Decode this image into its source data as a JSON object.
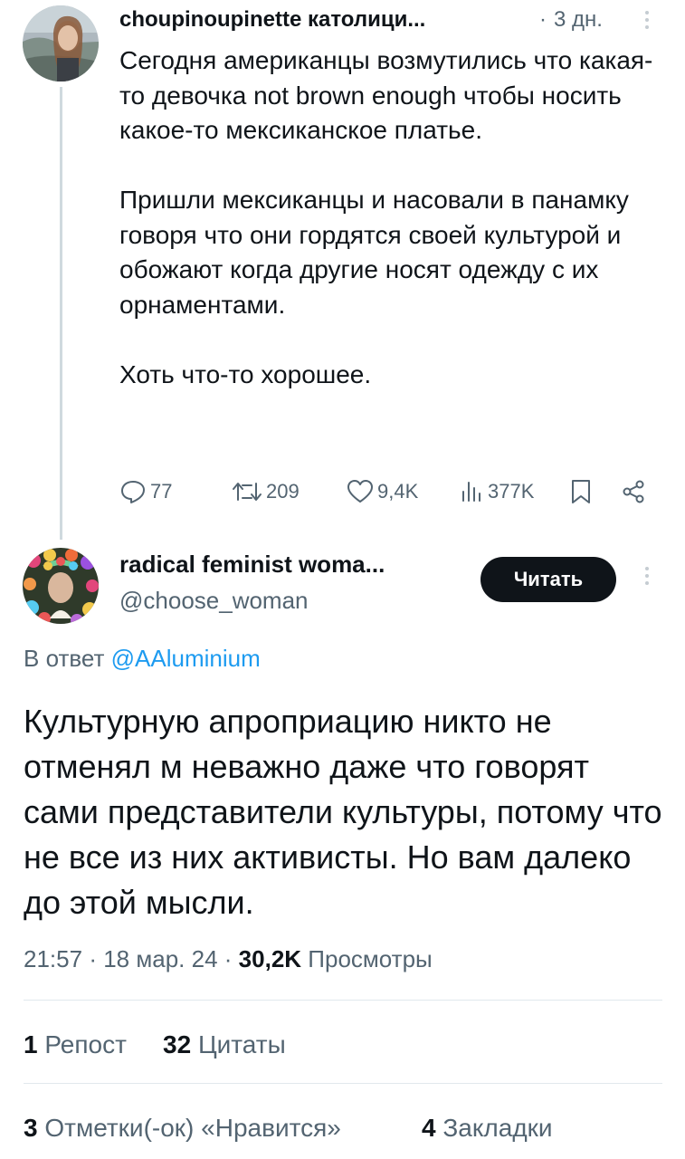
{
  "parent_tweet": {
    "author_name": "choupinoupinette католици...",
    "separator": "·",
    "time": "3 дн.",
    "paragraphs": [
      "Сегодня американцы возмутились что какая-то девочка not brown enough чтобы носить какое-то мексиканское платье.",
      "Пришли мексиканцы и насовали в панамку говоря что они гордятся своей культурой и обожают когда другие носят одежду с их орнаментами.",
      "Хоть что-то хорошее."
    ],
    "actions": {
      "replies": "77",
      "retweets": "209",
      "likes": "9,4K",
      "views": "377K"
    }
  },
  "reply_tweet": {
    "author_name": "radical feminist woma...",
    "handle": "@choose_woman",
    "follow_label": "Читать",
    "reply_prefix": "В ответ",
    "reply_mention": "@AAluminium",
    "text": "Культурную апроприацию никто не отменял м неважно даже что говорят сами представители культуры, потому что не все из них активисты. Но вам далеко до этой мысли.",
    "time": "21:57",
    "date": "18 мар. 24",
    "dot": "·",
    "views_count": "30,2K",
    "views_label": "Просмотры",
    "stats": {
      "reposts_count": "1",
      "reposts_label": "Репост",
      "quotes_count": "32",
      "quotes_label": "Цитаты",
      "likes_count": "3",
      "likes_label": "Отметки(-ок) «Нравится»",
      "bookmarks_count": "4",
      "bookmarks_label": "Закладки"
    }
  },
  "colors": {
    "text": "#0f1419",
    "secondary": "#536471",
    "link": "#1d9bf0",
    "button_bg": "#0f1419"
  }
}
